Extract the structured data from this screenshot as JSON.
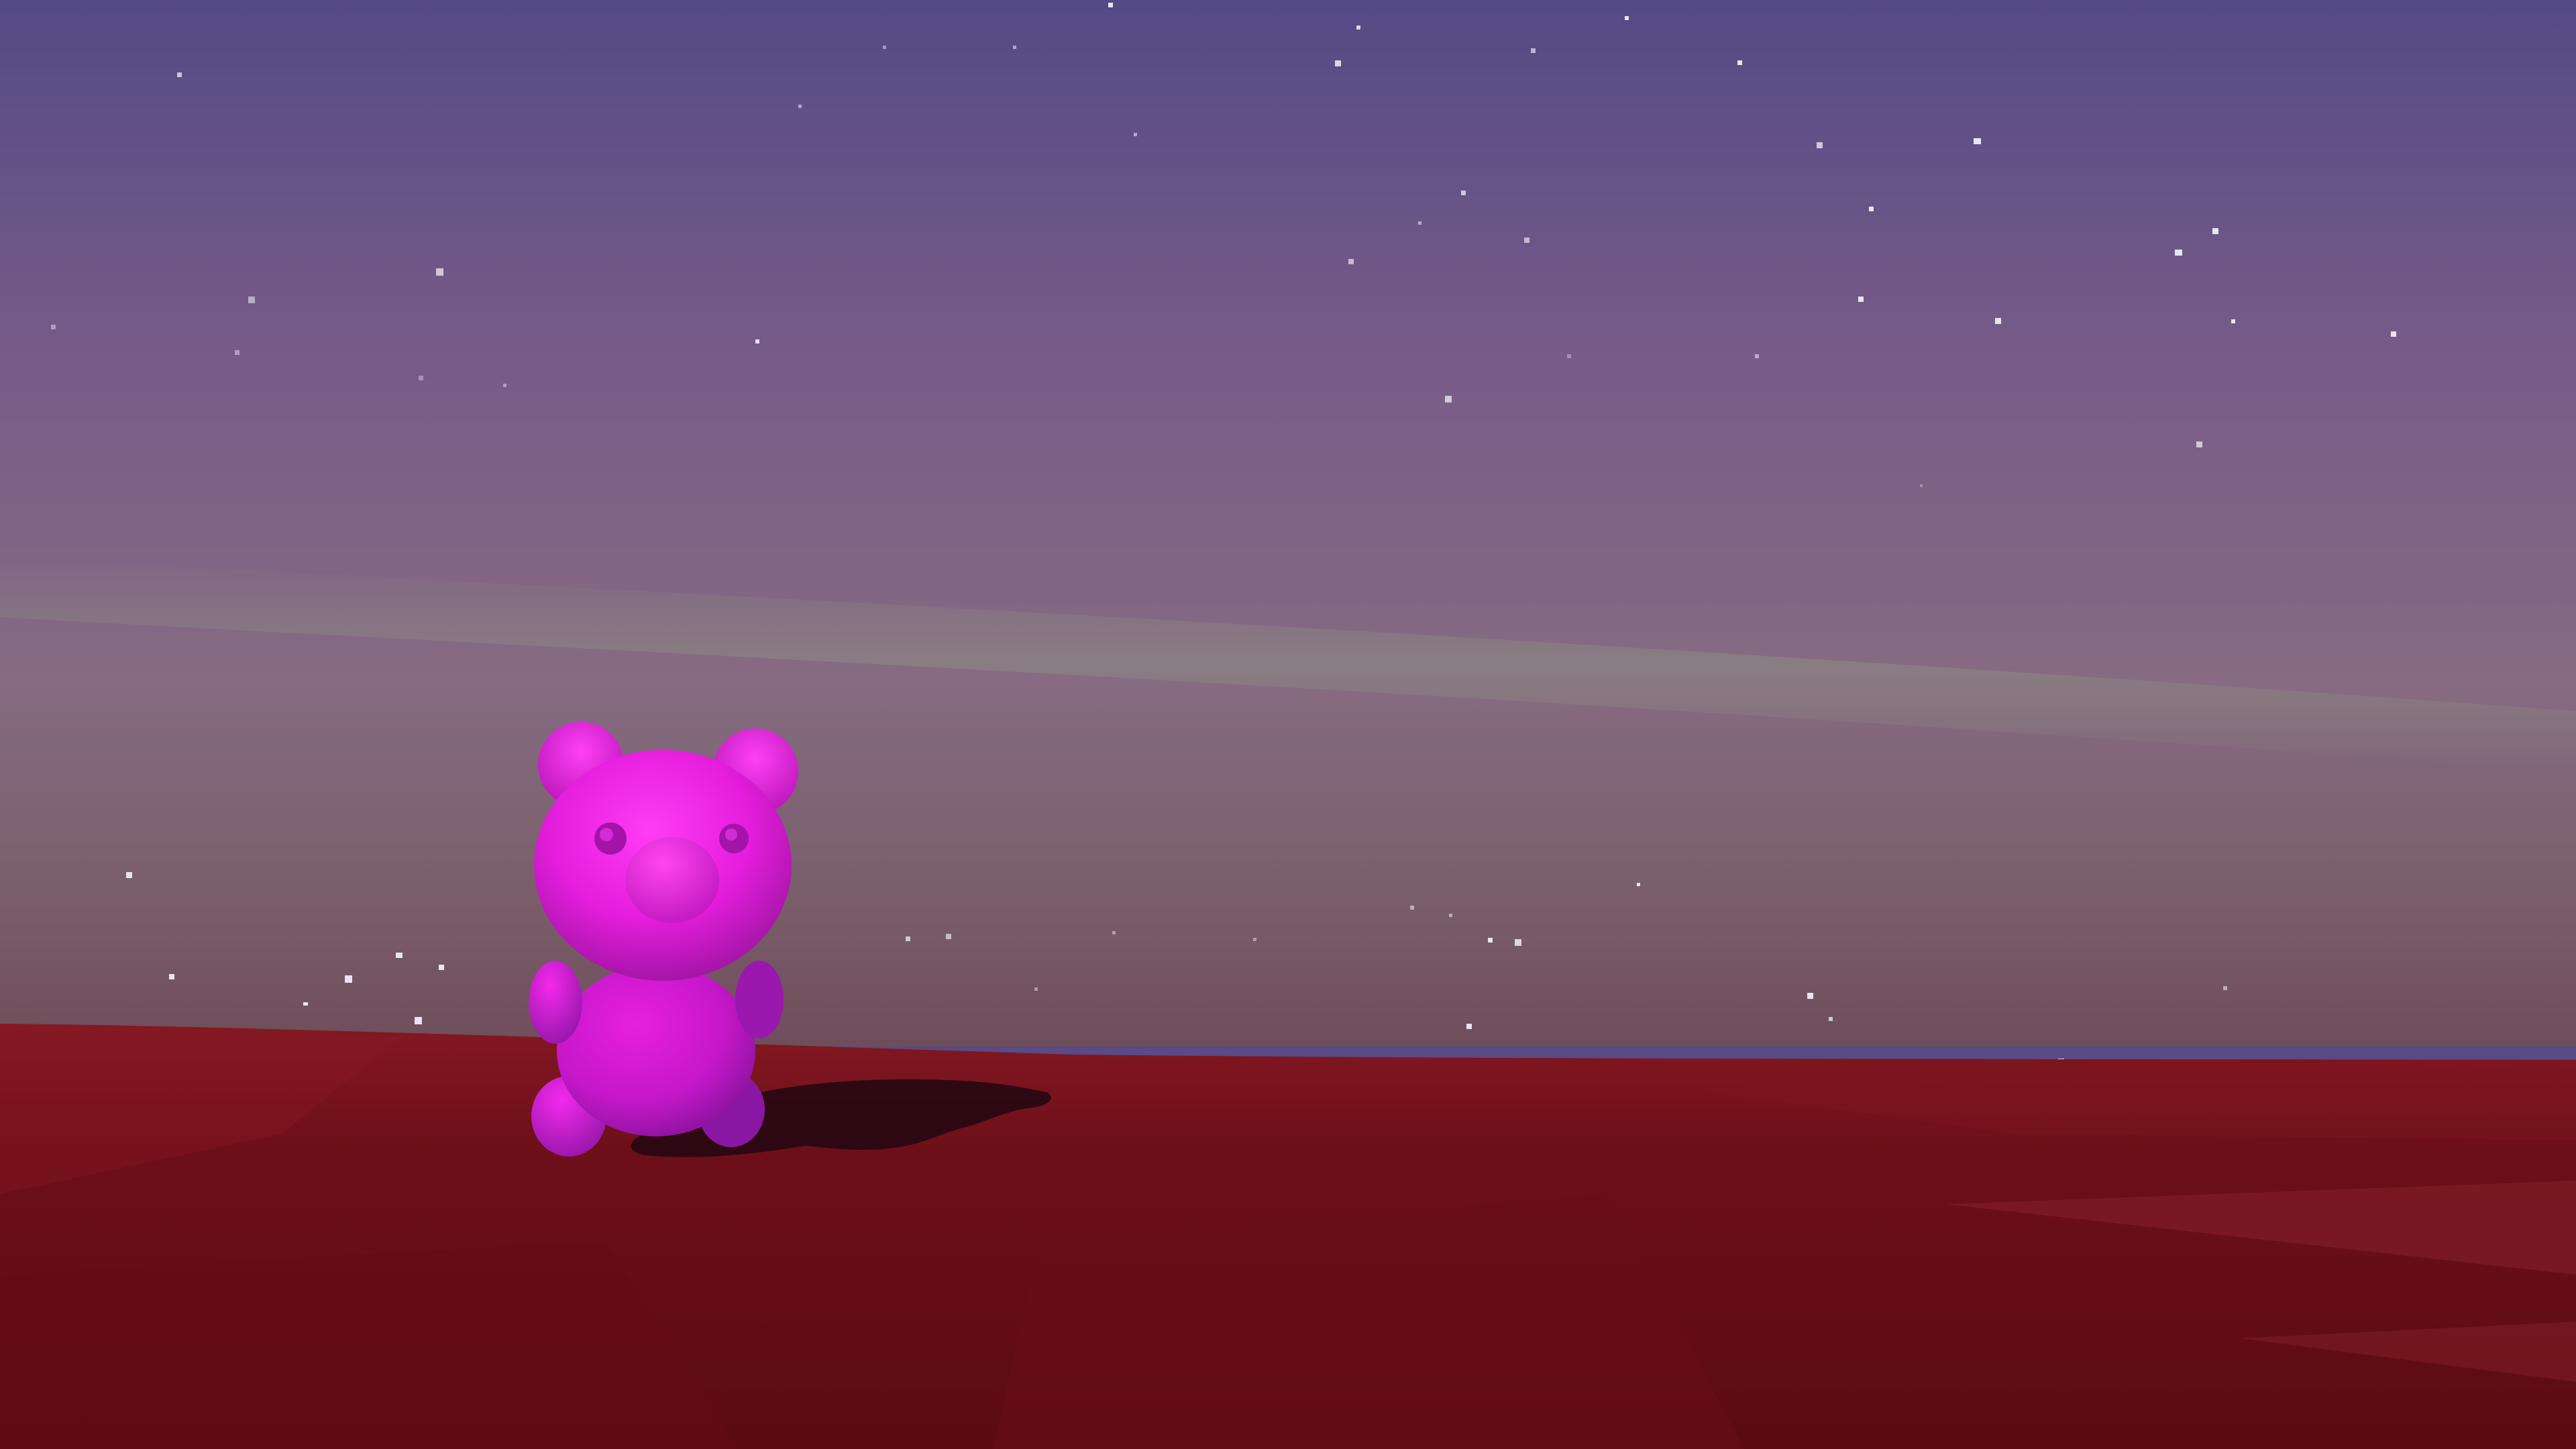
{
  "scene": {
    "colors": {
      "sky_top": "#574b86",
      "sky_mid": "#7b5f86",
      "sky_horizon": "#86707f",
      "aurora": "#8a8a80",
      "ground_near": "#5e0c12",
      "ground_far": "#8b1a24",
      "bear_main": "#ee1ee6",
      "bear_shade": "#8a1aa4",
      "shadow": "#280810",
      "star": "#e8e4f0"
    },
    "subjects": [
      "sky",
      "stars",
      "ground",
      "bear-character",
      "bear-shadow"
    ]
  }
}
